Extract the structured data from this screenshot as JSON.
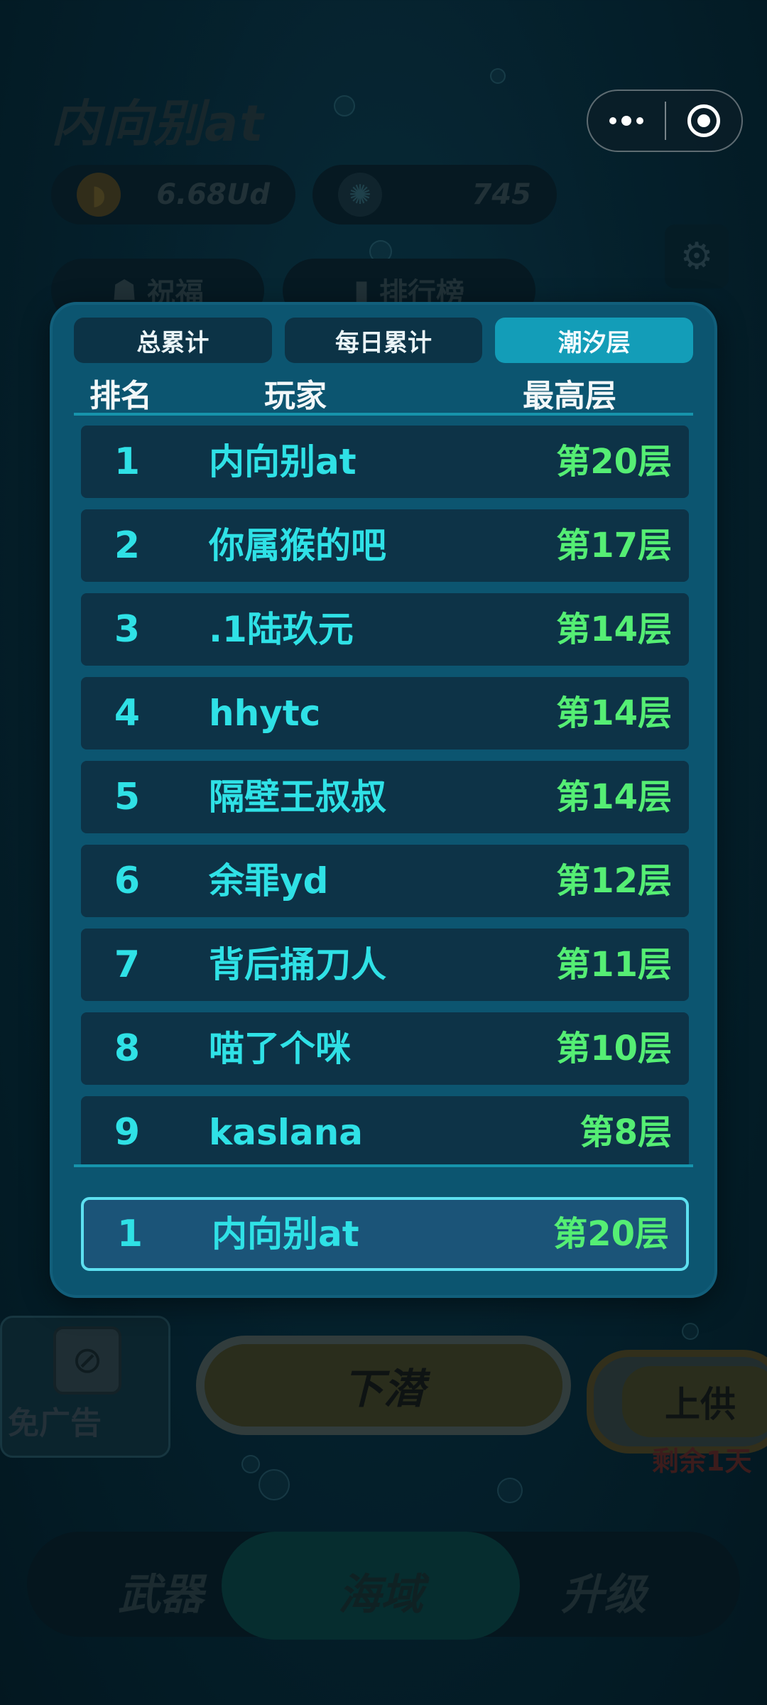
{
  "background": {
    "player_name": "内向别at",
    "shells_value": "6.68Ud",
    "pearls_value": "745",
    "tab_blessing": "祝福",
    "tab_rank": "排行榜",
    "ad_label": "免广告",
    "dive_label": "下潜",
    "offer_label": "上供",
    "remain_label": "剩余1天",
    "nav": {
      "weapon": "武器",
      "sea": "海域",
      "upgrade": "升级"
    }
  },
  "leaderboard": {
    "tabs": [
      {
        "label": "总累计"
      },
      {
        "label": "每日累计"
      },
      {
        "label": "潮汐层"
      }
    ],
    "active_tab": "潮汐层",
    "headers": {
      "rank": "排名",
      "player": "玩家",
      "best": "最高层"
    },
    "rows": [
      {
        "rank": "1",
        "name": "内向别at",
        "level": "第20层"
      },
      {
        "rank": "2",
        "name": "你属猴的吧",
        "level": "第17层"
      },
      {
        "rank": "3",
        "name": ".1陆玖元",
        "level": "第14层"
      },
      {
        "rank": "4",
        "name": "hhytc",
        "level": "第14层"
      },
      {
        "rank": "5",
        "name": "隔壁王叔叔",
        "level": "第14层"
      },
      {
        "rank": "6",
        "name": "余罪yd",
        "level": "第12层"
      },
      {
        "rank": "7",
        "name": "背后捅刀人",
        "level": "第11层"
      },
      {
        "rank": "8",
        "name": "喵了个咪",
        "level": "第10层"
      },
      {
        "rank": "9",
        "name": "kaslana",
        "level": "第8层"
      }
    ],
    "me": {
      "rank": "1",
      "name": "内向别at",
      "level": "第20层"
    }
  },
  "colors": {
    "accent": "#139db8",
    "rank_text": "#2fe1e6",
    "level_text": "#55ee74",
    "panel": "#0c5570"
  }
}
